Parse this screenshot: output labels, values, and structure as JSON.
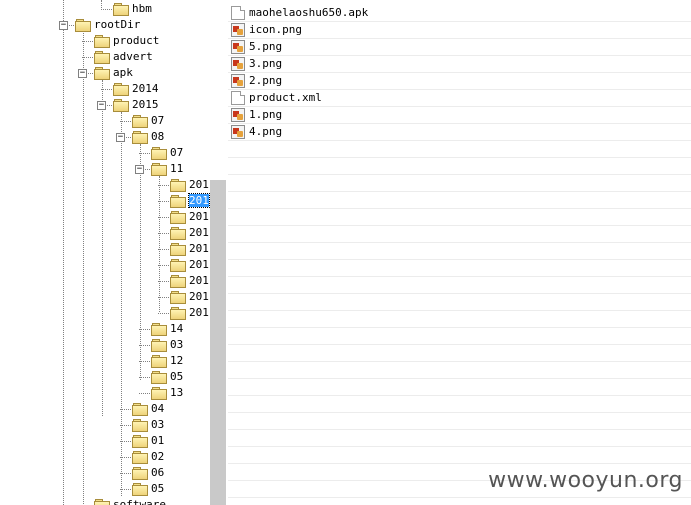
{
  "tree": {
    "nodes": [
      {
        "label": "hbm",
        "state": "leaf"
      },
      {
        "label": "rootDir",
        "state": "expanded"
      },
      {
        "label": "product",
        "state": "leaf"
      },
      {
        "label": "advert",
        "state": "leaf"
      },
      {
        "label": "apk",
        "state": "expanded"
      },
      {
        "label": "2014",
        "state": "leaf"
      },
      {
        "label": "2015",
        "state": "expanded"
      },
      {
        "label": "07",
        "state": "leaf"
      },
      {
        "label": "08",
        "state": "expanded"
      },
      {
        "label": "07",
        "state": "leaf"
      },
      {
        "label": "11",
        "state": "expanded"
      },
      {
        "label": "201",
        "state": "leaf"
      },
      {
        "label": "201",
        "state": "leaf",
        "selected": true
      },
      {
        "label": "201",
        "state": "leaf"
      },
      {
        "label": "201",
        "state": "leaf"
      },
      {
        "label": "201",
        "state": "leaf"
      },
      {
        "label": "201",
        "state": "leaf"
      },
      {
        "label": "201",
        "state": "leaf"
      },
      {
        "label": "201",
        "state": "leaf"
      },
      {
        "label": "201",
        "state": "leaf"
      },
      {
        "label": "14",
        "state": "leaf"
      },
      {
        "label": "03",
        "state": "leaf"
      },
      {
        "label": "12",
        "state": "leaf"
      },
      {
        "label": "05",
        "state": "leaf"
      },
      {
        "label": "13",
        "state": "leaf"
      },
      {
        "label": "04",
        "state": "leaf"
      },
      {
        "label": "03",
        "state": "leaf"
      },
      {
        "label": "01",
        "state": "leaf"
      },
      {
        "label": "02",
        "state": "leaf"
      },
      {
        "label": "06",
        "state": "leaf"
      },
      {
        "label": "05",
        "state": "leaf"
      },
      {
        "label": "software",
        "state": "leaf"
      }
    ]
  },
  "files": [
    {
      "name": "maohelaoshu650.apk",
      "icon": "document-icon"
    },
    {
      "name": "icon.png",
      "icon": "image-file-icon"
    },
    {
      "name": "5.png",
      "icon": "image-file-icon"
    },
    {
      "name": "3.png",
      "icon": "image-file-icon"
    },
    {
      "name": "2.png",
      "icon": "image-file-icon"
    },
    {
      "name": "product.xml",
      "icon": "document-icon"
    },
    {
      "name": "1.png",
      "icon": "image-file-icon"
    },
    {
      "name": "4.png",
      "icon": "image-file-icon"
    }
  ],
  "empty_rows": 21,
  "watermark": "www.wooyun.org",
  "colors": {
    "selection": "#3399ff",
    "folder": "#eed37a",
    "scroll_thumb": "#c9c9c9"
  }
}
